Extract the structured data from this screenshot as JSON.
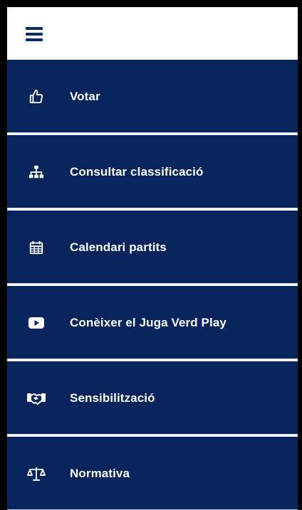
{
  "topbar": {
    "menu_icon": "hamburger-menu-icon",
    "accent_color": "#0f2a62"
  },
  "menu": {
    "background_color": "#08245d",
    "text_color": "#ffffff",
    "items": [
      {
        "label": "Votar",
        "icon": "thumbs-up-icon"
      },
      {
        "label": "Consultar classificació",
        "icon": "sitemap-icon"
      },
      {
        "label": "Calendari partits",
        "icon": "calendar-icon"
      },
      {
        "label": "Conèixer el Juga Verd Play",
        "icon": "youtube-play-icon"
      },
      {
        "label": "Sensibilització",
        "icon": "handshake-icon"
      },
      {
        "label": "Normativa",
        "icon": "balance-scale-icon"
      }
    ]
  }
}
